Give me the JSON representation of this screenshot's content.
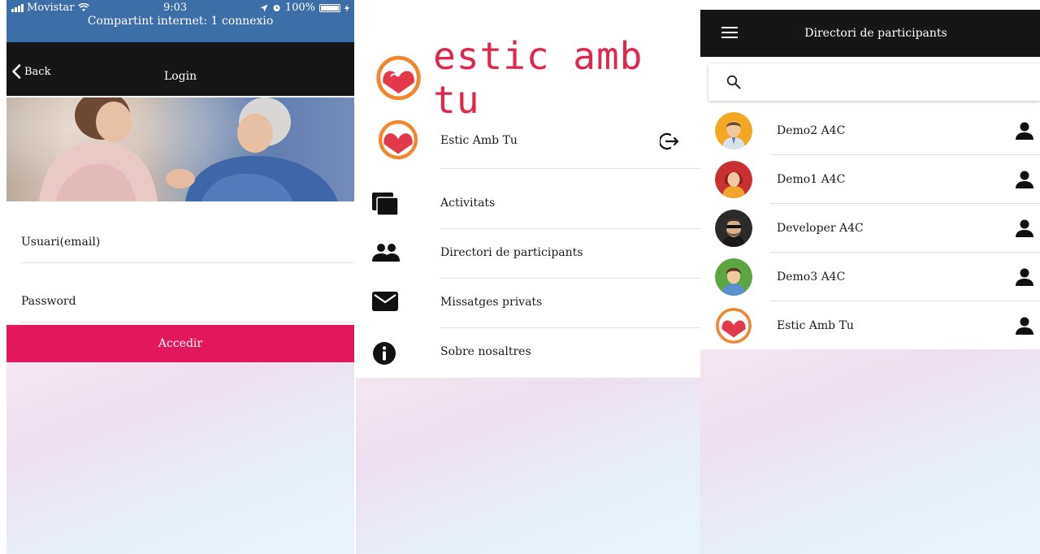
{
  "login_screen": {
    "status_bar": {
      "carrier": "Movistar",
      "time": "9:03",
      "battery": "100%",
      "hotspot": "Compartint internet: 1 connexio"
    },
    "nav": {
      "back_label": "Back",
      "title": "Login"
    },
    "email_placeholder": "Usuari(email)",
    "password_placeholder": "Password",
    "submit_label": "Accedir",
    "accent_color": "#e2175c"
  },
  "menu_screen": {
    "logo_text": "estic amb tu",
    "profile_name": "Estic Amb Tu",
    "items": [
      {
        "label": "Activitats",
        "icon": "stacked-squares-icon"
      },
      {
        "label": "Directori de participants",
        "icon": "people-icon"
      },
      {
        "label": "Missatges privats",
        "icon": "mail-icon"
      },
      {
        "label": "Sobre nosaltres",
        "icon": "info-icon"
      }
    ],
    "brand_color": "#e0264a"
  },
  "directory_screen": {
    "title": "Directori de participants",
    "search_value": "",
    "participants": [
      {
        "name": "Demo2 A4C",
        "avatar": "man-avatar-icon"
      },
      {
        "name": "Demo1 A4C",
        "avatar": "woman-red-avatar-icon"
      },
      {
        "name": "Developer A4C",
        "avatar": "developer-avatar-icon"
      },
      {
        "name": "Demo3 A4C",
        "avatar": "woman-green-avatar-icon"
      },
      {
        "name": "Estic Amb Tu",
        "avatar": "logo-avatar-icon"
      }
    ]
  }
}
